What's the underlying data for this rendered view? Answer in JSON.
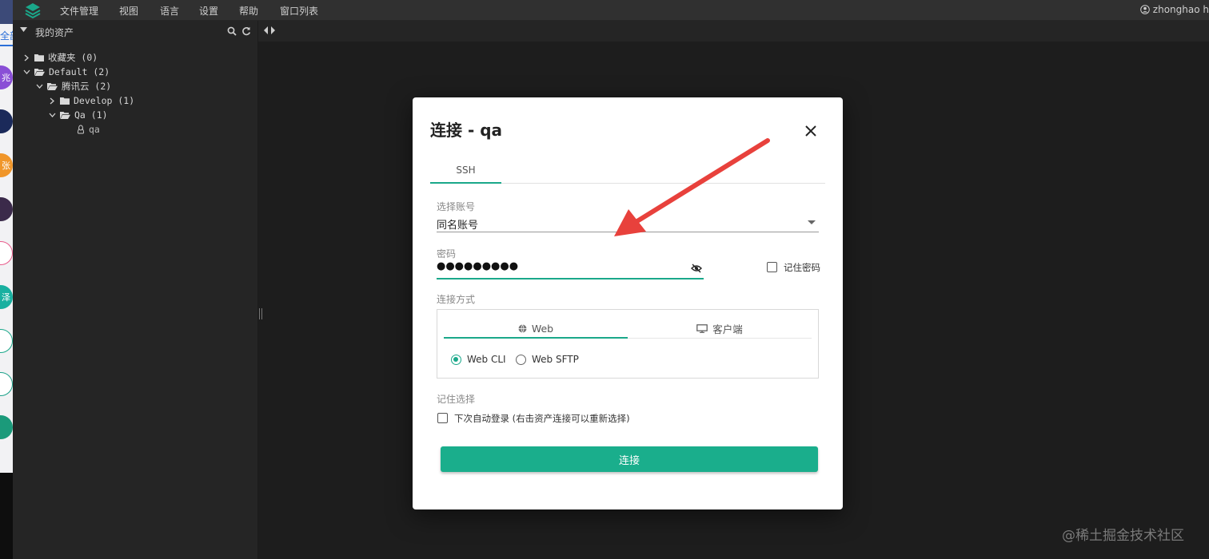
{
  "external_strip": {
    "tab_label": "全部",
    "avatars": [
      {
        "text": "兆",
        "color": "#8a4fd6"
      },
      {
        "text": "",
        "color": "#1b2a5a"
      },
      {
        "text": "张",
        "color": "#f0962a"
      },
      {
        "text": "",
        "color": "#3b2a4a"
      },
      {
        "text": "",
        "color": "#e85a8a"
      },
      {
        "text": "泽",
        "color": "#19b0a0"
      },
      {
        "text": "",
        "color": "#1aa88a"
      },
      {
        "text": "",
        "color": "#19a088"
      },
      {
        "text": "",
        "color": "#1b9a7a"
      }
    ]
  },
  "menubar": {
    "items": [
      "文件管理",
      "视图",
      "语言",
      "设置",
      "帮助",
      "窗口列表"
    ],
    "user": "zhonghao h"
  },
  "sidebar": {
    "title": "我的资产",
    "tree": [
      {
        "label": "收藏夹 (0)",
        "expanded": false,
        "icon": "folder-icon"
      },
      {
        "label": "Default (2)",
        "expanded": true,
        "icon": "folder-open-icon"
      },
      {
        "label": "腾讯云 (2)",
        "expanded": true,
        "icon": "folder-open-icon"
      },
      {
        "label": "Develop (1)",
        "expanded": false,
        "icon": "folder-icon"
      },
      {
        "label": "Qa (1)",
        "expanded": true,
        "icon": "folder-open-icon"
      },
      {
        "label": "qa",
        "expanded": null,
        "icon": "linux-icon"
      }
    ]
  },
  "modal": {
    "title": "连接 - qa",
    "tab": "SSH",
    "account_label": "选择账号",
    "account_value": "同名账号",
    "password_label": "密码",
    "password_value": "●●●●●●●●●",
    "remember_password": "记住密码",
    "method_label": "连接方式",
    "method_tabs": {
      "web": "Web",
      "client": "客户端"
    },
    "radios": {
      "cli": "Web CLI",
      "sftp": "Web SFTP"
    },
    "remember_choice_label": "记住选择",
    "auto_login": "下次自动登录 (右击资产连接可以重新选择)",
    "connect_button": "连接"
  },
  "colors": {
    "accent": "#1aa88a",
    "arrow": "#e8413c"
  },
  "watermark": "@稀土掘金技术社区"
}
